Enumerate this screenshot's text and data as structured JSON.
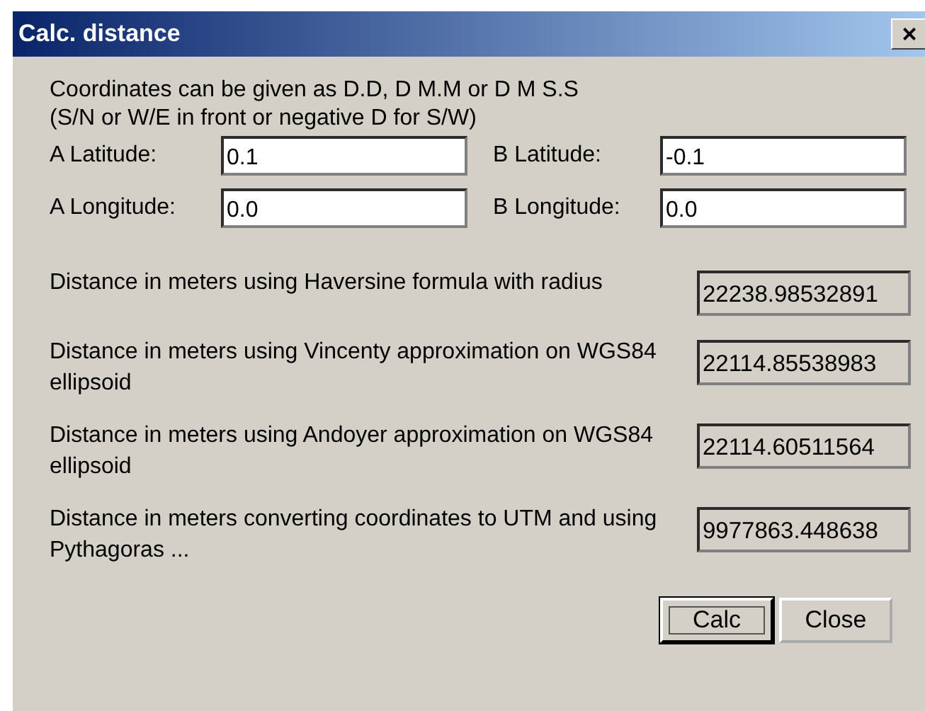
{
  "window": {
    "title": "Calc. distance",
    "close": "×"
  },
  "instructions": [
    "Coordinates can be given as D.D, D M.M or D M S.S",
    "(S/N or W/E in front or negative D for S/W)"
  ],
  "fields": [
    {
      "label": "A Latitude:",
      "value": "0.1"
    },
    {
      "label": "B Latitude:",
      "value": "-0.1"
    },
    {
      "label": "A Longitude:",
      "value": "0.0"
    },
    {
      "label": "B Longitude:",
      "value": "0.0"
    }
  ],
  "results": [
    {
      "label": "Distance in meters using Haversine formula with radius",
      "value": "22238.98532891"
    },
    {
      "label": "Distance in meters using Vincenty  approximation on WGS84 ellipsoid",
      "value": "22114.85538983"
    },
    {
      "label": "Distance in meters using Andoyer  approximation on WGS84 ellipsoid",
      "value": "22114.60511564"
    },
    {
      "label": "Distance in meters converting coordinates to UTM and using Pythagoras ...",
      "value": "9977863.448638"
    }
  ],
  "buttons": [
    {
      "label": "Calc",
      "default": true
    },
    {
      "label": "Close",
      "default": false
    }
  ]
}
